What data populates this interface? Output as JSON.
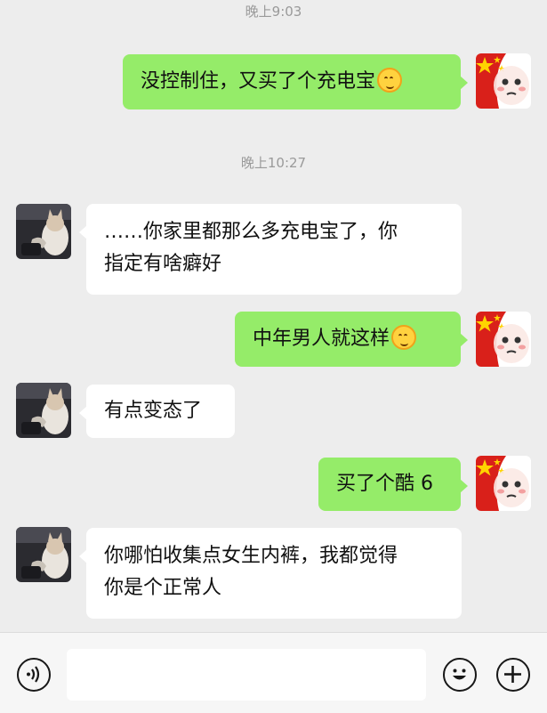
{
  "conversation": {
    "messages": [
      {
        "kind": "time",
        "text": "晚上9:03"
      },
      {
        "kind": "msg",
        "side": "right",
        "lines": [
          "没控制住，又买了个充电宝"
        ],
        "emoji": "smiling-face"
      },
      {
        "kind": "time",
        "text": "晚上10:27"
      },
      {
        "kind": "msg",
        "side": "left",
        "lines": [
          "……你家里都那么多充电宝了，你",
          "指定有啥癖好"
        ]
      },
      {
        "kind": "msg",
        "side": "right",
        "lines": [
          "中年男人就这样"
        ],
        "emoji": "smiling-face"
      },
      {
        "kind": "msg",
        "side": "left",
        "lines": [
          "有点变态了"
        ]
      },
      {
        "kind": "msg",
        "side": "right",
        "lines": [
          "买了个酷 6"
        ]
      },
      {
        "kind": "msg",
        "side": "left",
        "lines": [
          "你哪怕收集点女生内裤，我都觉得",
          "你是个正常人"
        ]
      }
    ]
  },
  "avatars": {
    "me": "flag-cartoon-face",
    "other": "cat-photo"
  },
  "input_bar": {
    "voice_icon": "voice-icon",
    "message_value": "",
    "emoji_icon": "emoji-icon",
    "plus_icon": "plus-icon"
  },
  "colors": {
    "background": "#ededed",
    "my_bubble": "#95ec69",
    "their_bubble": "#ffffff",
    "timestamp": "#9a9a9a"
  }
}
